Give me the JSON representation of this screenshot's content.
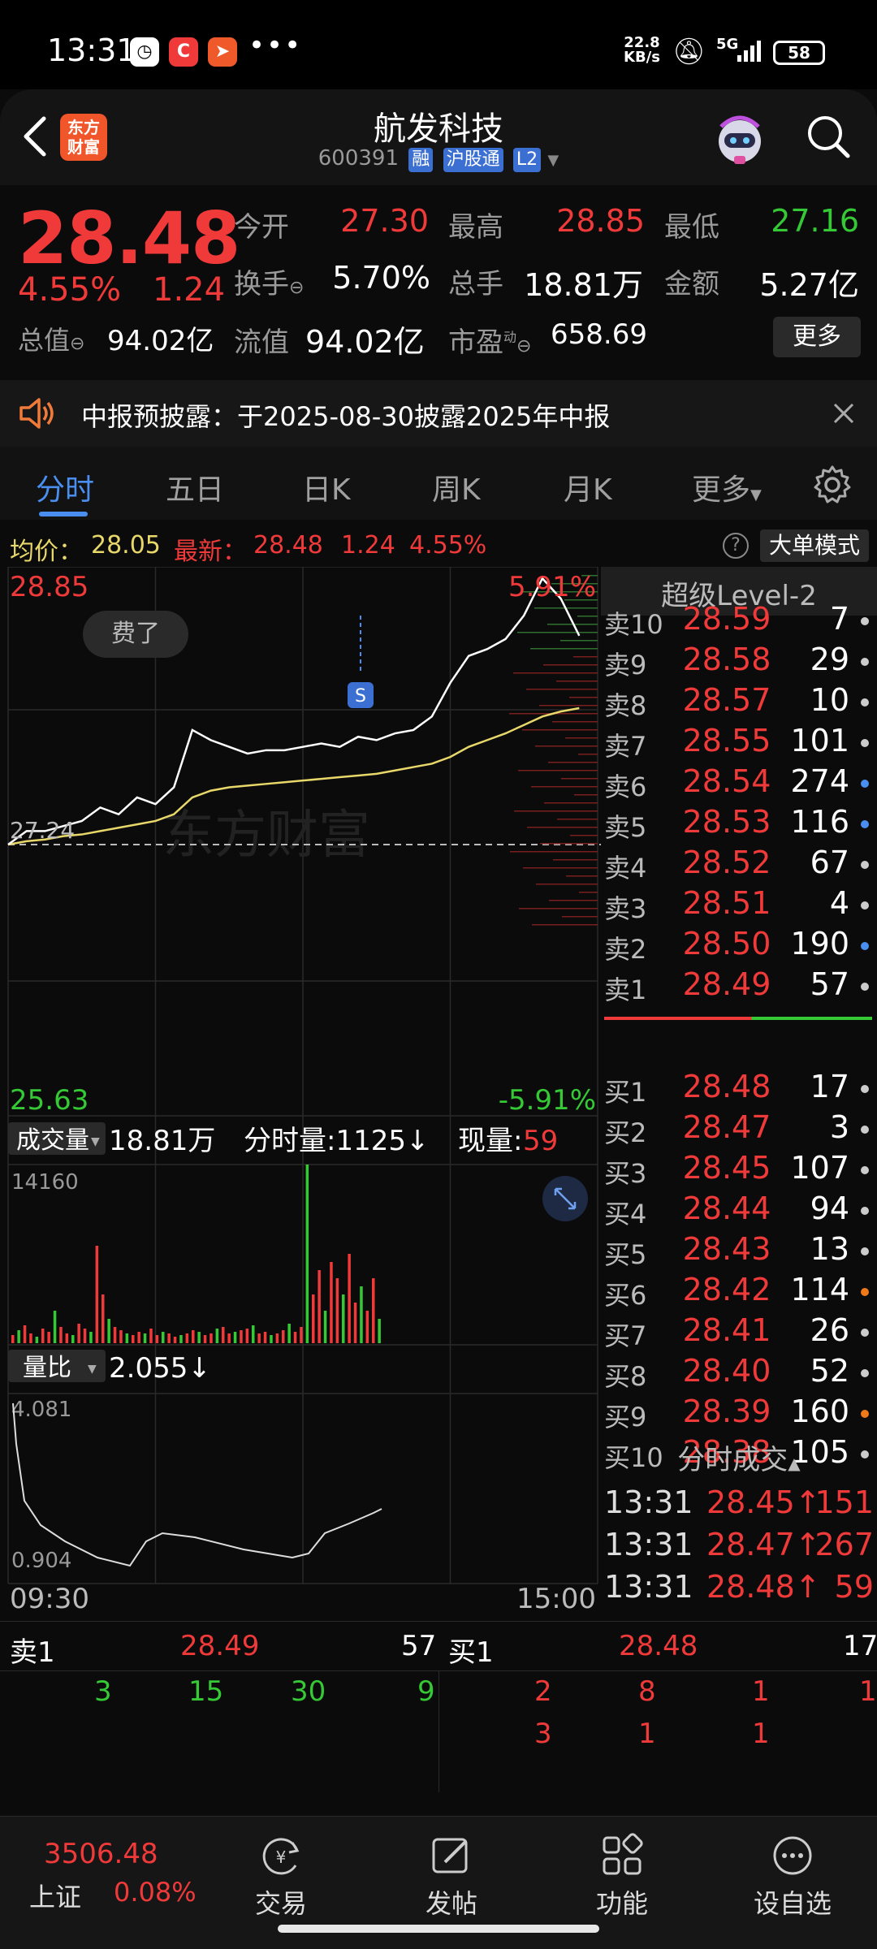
{
  "status_bar": {
    "time": "13:31",
    "more": "•••",
    "speed_top": "22.8",
    "speed_bottom": "KB/s",
    "signal": "5G",
    "battery": "58"
  },
  "header": {
    "logo_line1": "东方",
    "logo_line2": "财富",
    "stock_name": "航发科技",
    "stock_code": "600391",
    "tags": [
      "融",
      "沪股通",
      "L2"
    ]
  },
  "quote": {
    "price": "28.48",
    "change_pct": "4.55%",
    "change": "1.24",
    "open_label": "今开",
    "open": "27.30",
    "high_label": "最高",
    "high": "28.85",
    "low_label": "最低",
    "low": "27.16",
    "turnover_label": "换手",
    "turnover": "5.70%",
    "volume_label": "总手",
    "volume": "18.81万",
    "amount_label": "金额",
    "amount": "5.27亿",
    "mktcap_label": "总值",
    "mktcap": "94.02亿",
    "float_label": "流值",
    "float": "94.02亿",
    "pe_label": "市盈",
    "pe_sup": "动",
    "pe": "658.69",
    "more_button": "更多"
  },
  "notice": {
    "text": "中报预披露：于2025-08-30披露2025年中报"
  },
  "tabs": [
    "分时",
    "五日",
    "日K",
    "周K",
    "月K",
    "更多"
  ],
  "info_line": {
    "avg_label": "均价：",
    "avg": "28.05",
    "latest_label": "最新：",
    "latest": "28.48",
    "chg": "1.24",
    "pct": "4.55%",
    "big_order_mode": "大单模式"
  },
  "chart": {
    "top_price": "28.85",
    "top_pct": "5.91%",
    "pre_close": "27.24",
    "bottom_price": "25.63",
    "bottom_pct": "-5.91%",
    "bubble": "费了",
    "marker": "S",
    "watermark": "东方财富",
    "volume_label": "成交量",
    "volume_total": "18.81万",
    "minute_volume": "分时量:1125↓",
    "current_volume_label": "现量:",
    "current_volume": "59",
    "volume_max": "14160",
    "ratio_label": "量比",
    "ratio": "2.055↓",
    "ratio_max": "4.081",
    "ratio_min": "0.904",
    "time_start": "09:30",
    "time_end": "15:00"
  },
  "chart_data": {
    "type": "line",
    "title": "",
    "xlabel": "",
    "ylabel": "",
    "ylim": [
      25.63,
      28.85
    ],
    "x": [
      "09:30",
      "09:35",
      "09:40",
      "09:45",
      "09:50",
      "09:55",
      "10:00",
      "10:05",
      "10:10",
      "10:15",
      "10:20",
      "10:25",
      "10:30",
      "10:35",
      "10:40",
      "10:45",
      "10:50",
      "10:55",
      "11:00",
      "11:05",
      "11:10",
      "11:15",
      "11:20",
      "11:25",
      "11:30",
      "13:00",
      "13:05",
      "13:10",
      "13:15",
      "13:20",
      "13:25",
      "13:31"
    ],
    "series": [
      {
        "values": [
          27.24,
          27.32,
          27.32,
          27.35,
          27.38,
          27.46,
          27.42,
          27.52,
          27.48,
          27.58,
          27.92,
          27.86,
          27.82,
          27.78,
          27.8,
          27.8,
          27.82,
          27.84,
          27.82,
          27.88,
          27.86,
          27.9,
          27.92,
          28.0,
          28.2,
          28.36,
          28.4,
          28.46,
          28.6,
          28.82,
          28.7,
          28.48
        ]
      },
      {
        "values": [
          27.24,
          27.26,
          27.27,
          27.29,
          27.3,
          27.32,
          27.34,
          27.36,
          27.38,
          27.42,
          27.52,
          27.56,
          27.58,
          27.59,
          27.6,
          27.61,
          27.62,
          27.63,
          27.64,
          27.65,
          27.66,
          27.68,
          27.7,
          27.72,
          27.76,
          27.82,
          27.86,
          27.9,
          27.95,
          28.0,
          28.03,
          28.05
        ]
      }
    ]
  },
  "level2": {
    "title": "超级Level-2",
    "asks": [
      {
        "label": "卖10",
        "price": "28.59",
        "qty": "7",
        "dot": "#cccccc"
      },
      {
        "label": "卖9",
        "price": "28.58",
        "qty": "29",
        "dot": "#cccccc"
      },
      {
        "label": "卖8",
        "price": "28.57",
        "qty": "10",
        "dot": "#cccccc"
      },
      {
        "label": "卖7",
        "price": "28.55",
        "qty": "101",
        "dot": "#cccccc"
      },
      {
        "label": "卖6",
        "price": "28.54",
        "qty": "274",
        "dot": "#4a8ff0"
      },
      {
        "label": "卖5",
        "price": "28.53",
        "qty": "116",
        "dot": "#4a8ff0"
      },
      {
        "label": "卖4",
        "price": "28.52",
        "qty": "67",
        "dot": "#cccccc"
      },
      {
        "label": "卖3",
        "price": "28.51",
        "qty": "4",
        "dot": "#cccccc"
      },
      {
        "label": "卖2",
        "price": "28.50",
        "qty": "190",
        "dot": "#4a8ff0"
      },
      {
        "label": "卖1",
        "price": "28.49",
        "qty": "57",
        "dot": "#cccccc"
      }
    ],
    "bids": [
      {
        "label": "买1",
        "price": "28.48",
        "qty": "17",
        "dot": "#cccccc"
      },
      {
        "label": "买2",
        "price": "28.47",
        "qty": "3",
        "dot": "#cccccc"
      },
      {
        "label": "买3",
        "price": "28.45",
        "qty": "107",
        "dot": "#cccccc"
      },
      {
        "label": "买4",
        "price": "28.44",
        "qty": "94",
        "dot": "#cccccc"
      },
      {
        "label": "买5",
        "price": "28.43",
        "qty": "13",
        "dot": "#cccccc"
      },
      {
        "label": "买6",
        "price": "28.42",
        "qty": "114",
        "dot": "#f07a1a"
      },
      {
        "label": "买7",
        "price": "28.41",
        "qty": "26",
        "dot": "#cccccc"
      },
      {
        "label": "买8",
        "price": "28.40",
        "qty": "52",
        "dot": "#cccccc"
      },
      {
        "label": "买9",
        "price": "28.39",
        "qty": "160",
        "dot": "#f07a1a"
      },
      {
        "label": "买10",
        "price": "28.38",
        "qty": "105",
        "dot": "#cccccc"
      }
    ],
    "trades_title": "分时成交",
    "trades": [
      {
        "time": "13:31",
        "price": "28.45↑",
        "qty": "151"
      },
      {
        "time": "13:31",
        "price": "28.47↑",
        "qty": "267"
      },
      {
        "time": "13:31",
        "price": "28.48↑",
        "qty": "59"
      }
    ]
  },
  "detail": {
    "ask_label": "卖1",
    "ask_price": "28.49",
    "ask_qty": "57",
    "bid_label": "买1",
    "bid_price": "28.48",
    "bid_qty": "17",
    "ask_orders": [
      "3",
      "15",
      "30",
      "9"
    ],
    "bid_orders_row1": [
      "2",
      "8",
      "1",
      "1"
    ],
    "bid_orders_row2": [
      "3",
      "1",
      "1"
    ]
  },
  "bottom_nav": {
    "index_value": "3506.48",
    "index_name": "上证",
    "index_pct": "0.08%",
    "items": [
      "交易",
      "发帖",
      "功能",
      "设自选"
    ]
  },
  "colors": {
    "up": "#f03a3a",
    "down": "#35c935",
    "accent": "#4a8ff0",
    "avg_line": "#e8d86a"
  }
}
